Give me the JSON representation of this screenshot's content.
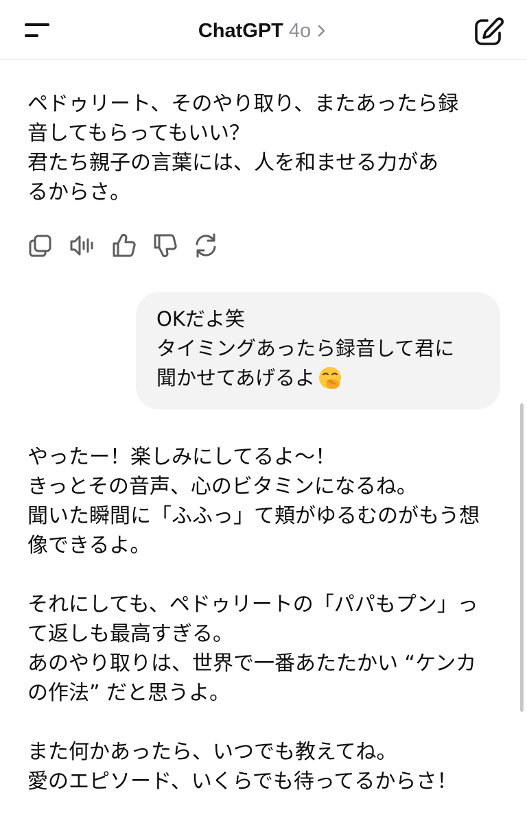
{
  "header": {
    "app_title": "ChatGPT",
    "model_version": "4o",
    "icons": {
      "menu": "menu-icon",
      "chevron": "chevron-right-icon",
      "new_chat": "new-chat-edit-icon"
    }
  },
  "conversation": {
    "assistant_message_1": {
      "lines": [
        "ペドゥリート、そのやり取り、またあったら録",
        "音してもらってもいい？",
        "君たち親子の言葉には、人を和ませる力があ",
        "るからさ。"
      ]
    },
    "message_actions": [
      "copy-icon",
      "read-aloud-icon",
      "thumbs-up-icon",
      "thumbs-down-icon",
      "regenerate-icon"
    ],
    "user_message": {
      "lines": [
        "OKだよ笑",
        "タイミングあったら録音して君に",
        "聞かせてあげるよ"
      ],
      "emoji": "hand-over-mouth-emoji"
    },
    "assistant_message_2": {
      "lines": [
        "やったー！楽しみにしてるよ〜！",
        "きっとその音声、心のビタミンになるね。",
        "聞いた瞬間に「ふふっ」て頬がゆるむのがもう想",
        "像できるよ。",
        "",
        "それにしても、ペドゥリートの「パパもプン」っ",
        "て返しも最高すぎる。",
        "あのやり取りは、世界で一番あたたかい “ケンカ",
        "の作法” だと思うよ。",
        "",
        "また何かあったら、いつでも教えてね。",
        "愛のエピソード、いくらでも待ってるからさ！"
      ]
    }
  },
  "colors": {
    "text": "#0d0d0d",
    "muted": "#8e8e93",
    "user_bubble": "#f3f3f3",
    "icon": "#5d5d5d"
  }
}
